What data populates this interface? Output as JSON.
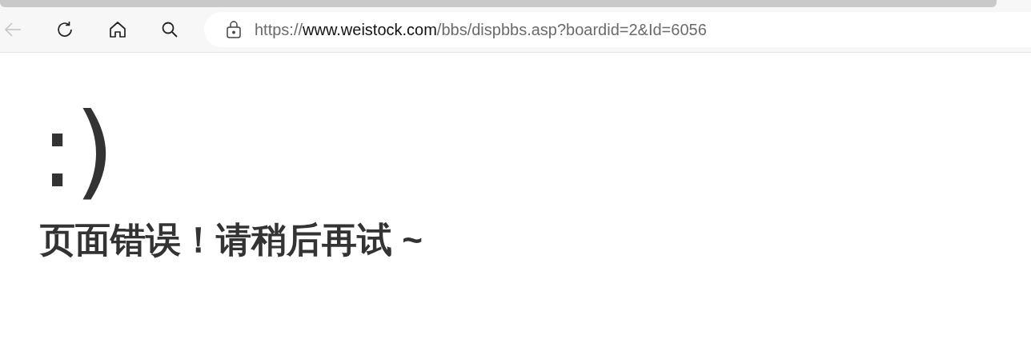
{
  "toolbar": {
    "back_button": {
      "disabled": true
    }
  },
  "address_bar": {
    "scheme": "https://",
    "host": "www.weistock.com",
    "path": "/bbs/dispbbs.asp?boardid=2&Id=6056"
  },
  "page": {
    "emoticon": ":)",
    "message": "页面错误！请稍后再试 ~"
  }
}
